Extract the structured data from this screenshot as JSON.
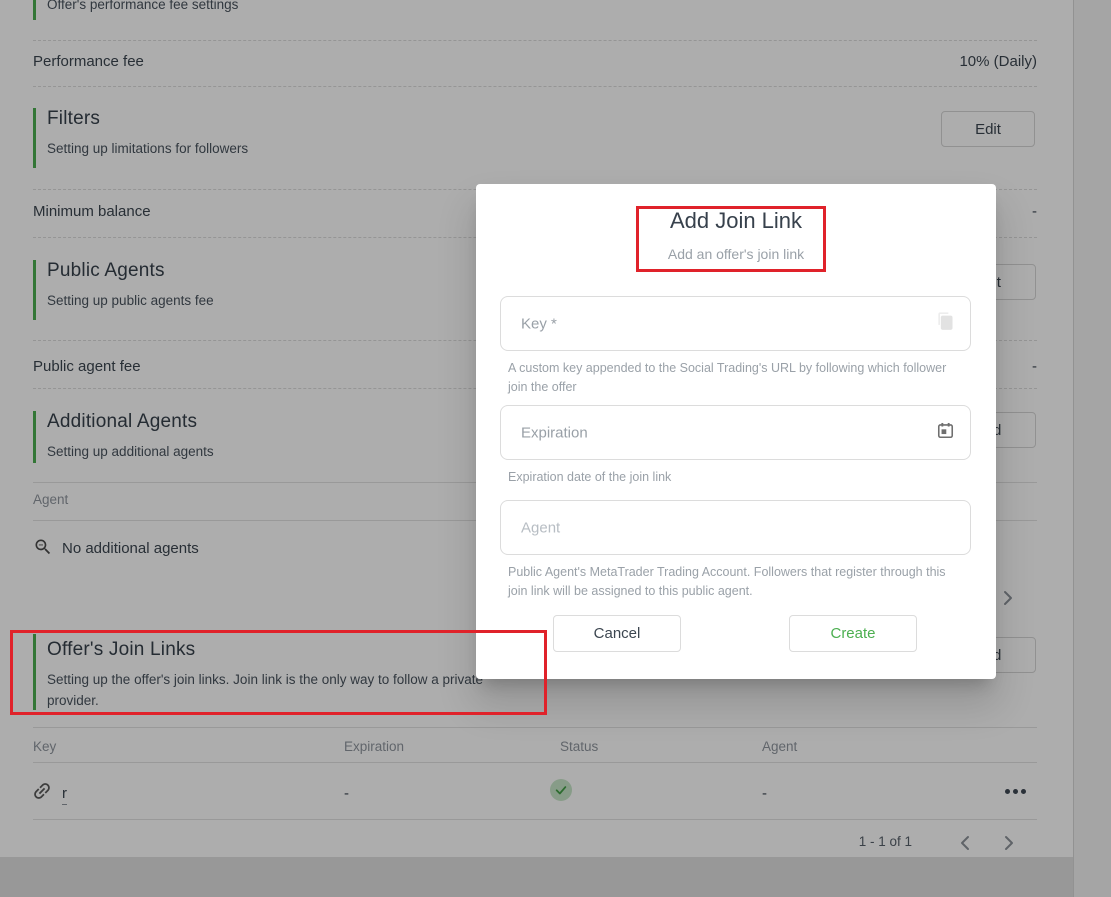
{
  "colors": {
    "accent_green": "#4caf50",
    "annotation_red": "#e0222a",
    "status_check_bg": "#c8e6c9",
    "status_check_mark": "#43a047"
  },
  "page": {
    "top_subtitle": "Offer's performance fee settings",
    "performance_fee": {
      "label": "Performance fee",
      "value": "10% (Daily)"
    },
    "filters": {
      "title": "Filters",
      "subtitle": "Setting up limitations for followers",
      "button": "Edit"
    },
    "minimum_balance": {
      "label": "Minimum balance",
      "value": "-"
    },
    "public_agents": {
      "title": "Public Agents",
      "subtitle": "Setting up public agents fee",
      "button": "Edit"
    },
    "public_agent_fee": {
      "label": "Public agent fee",
      "value": "-"
    },
    "additional_agents": {
      "title": "Additional Agents",
      "subtitle": "Setting up additional agents",
      "button": "Add",
      "table": {
        "header": "Agent",
        "empty_icon": "zoom-out-icon",
        "empty_text": "No additional agents"
      }
    },
    "join_links": {
      "title": "Offer's Join Links",
      "subtitle": "Setting up the offer's join links. Join link is the only way to follow a private provider.",
      "button": "Add",
      "table": {
        "headers": [
          "Key",
          "Expiration",
          "Status",
          "Agent"
        ],
        "row": {
          "key_icon": "link-icon",
          "key": "r",
          "expiration": "-",
          "status_icon": "check-circle-icon",
          "agent": "-",
          "actions_icon": "ellipsis-menu-icon"
        }
      },
      "pagination": {
        "label": "1 - 1 of 1",
        "prev_icon": "chevron-left-icon",
        "next_icon": "chevron-right-icon"
      }
    }
  },
  "modal": {
    "title": "Add Join Link",
    "subtitle": "Add an offer's join link",
    "fields": [
      {
        "label": "Key *",
        "icon": "copy-icon",
        "helper": "A custom key appended to the Social Trading's URL by following which follower join the offer"
      },
      {
        "label": "Expiration",
        "icon": "calendar-icon",
        "helper": "Expiration date of the join link"
      },
      {
        "placeholder": "Agent",
        "helper": "Public Agent's MetaTrader Trading Account. Followers that register through this join link will be assigned to this public agent."
      }
    ],
    "cancel": "Cancel",
    "create": "Create"
  }
}
